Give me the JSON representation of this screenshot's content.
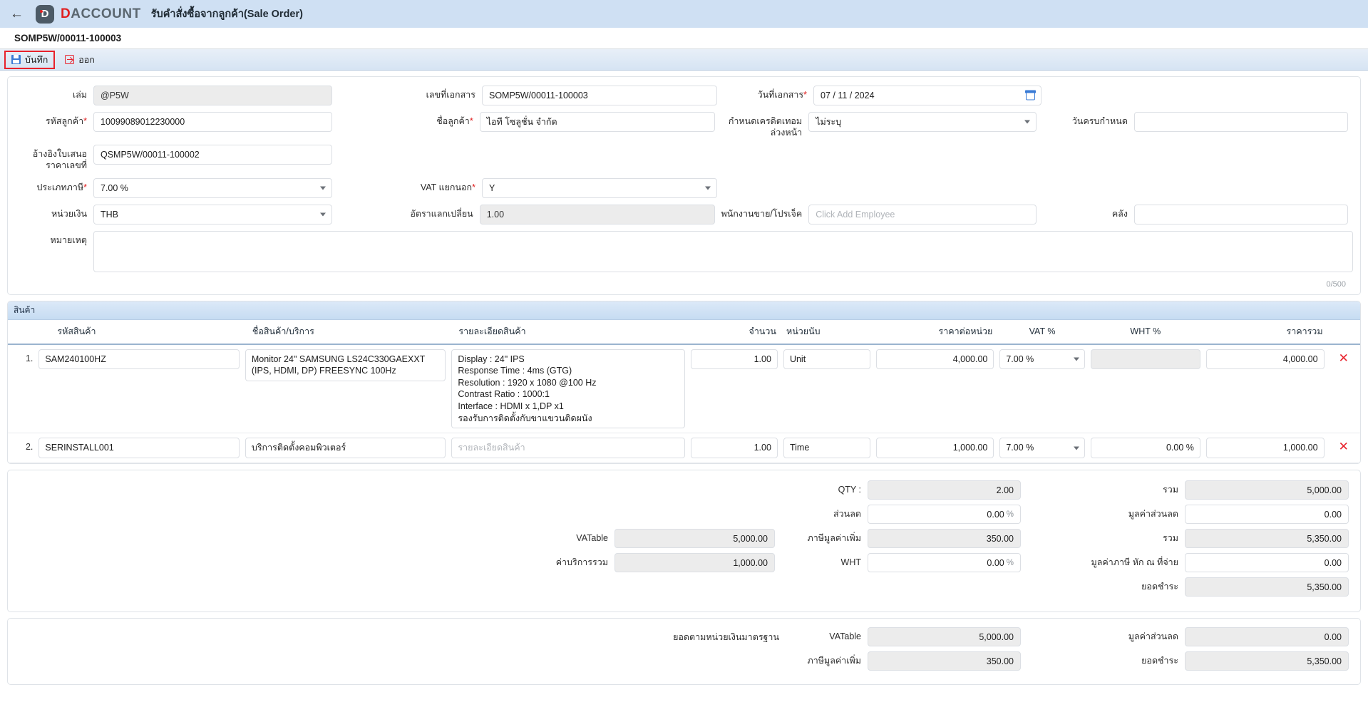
{
  "appbar": {
    "back_icon": "arrow-left-icon",
    "brand_first": "D",
    "brand_rest": "ACCOUNT",
    "title": "รับคำสั่งซื้อจากลูกค้า(Sale Order)"
  },
  "doc_no": "SOMP5W/00011-100003",
  "toolbar": {
    "save_label": "บันทึก",
    "exit_label": "ออก"
  },
  "form": {
    "book_label": "เล่ม",
    "book_value": "@P5W",
    "docno_label": "เลขที่เอกสาร",
    "docno_value": "SOMP5W/00011-100003",
    "docdate_label": "วันที่เอกสาร",
    "docdate_value": "07 / 11 / 2024",
    "custcode_label": "รหัสลูกค้า",
    "custcode_value": "10099089012230000",
    "custname_label": "ชื่อลูกค้า",
    "custname_value": "ไอที โซลูชั่น จำกัด",
    "credit_label": "กำหนดเครดิตเทอมล่วงหน้า",
    "credit_value": "ไม่ระบุ",
    "duedate_label": "วันครบกำหนด",
    "duedate_value": "",
    "quoteref_label": "อ้างอิงใบเสนอราคาเลขที่",
    "quoteref_value": "QSMP5W/00011-100002",
    "taxtype_label": "ประเภทภาษี",
    "taxtype_value": "7.00 %",
    "vatout_label": "VAT แยกนอก",
    "vatout_value": "Y",
    "currency_label": "หน่วยเงิน",
    "currency_value": "THB",
    "exrate_label": "อัตราแลกเปลี่ยน",
    "exrate_value": "1.00",
    "employee_label": "พนักงานขาย/โปรเจ็ค",
    "employee_placeholder": "Click Add Employee",
    "employee_value": "",
    "warehouse_label": "คลัง",
    "warehouse_value": "",
    "note_label": "หมายเหตุ",
    "note_value": "",
    "note_counter": "0/500"
  },
  "items": {
    "section_title": "สินค้า",
    "columns": {
      "code": "รหัสสินค้า",
      "name": "ชื่อสินค้า/บริการ",
      "detail": "รายละเอียดสินค้า",
      "qty": "จำนวน",
      "unit": "หน่วยนับ",
      "price": "ราคาต่อหน่วย",
      "vat": "VAT %",
      "wht": "WHT %",
      "total": "ราคารวม"
    },
    "detail_placeholder": "รายละเอียดสินค้า",
    "rows": [
      {
        "index": "1.",
        "code": "SAM240100HZ",
        "name": "Monitor 24\" SAMSUNG LS24C330GAEXXT (IPS, HDMI, DP) FREESYNC 100Hz",
        "detail": "Display : 24\" IPS\nResponse Time : 4ms (GTG)\nResolution : 1920 x 1080 @100 Hz\nContrast Ratio : 1000:1\nInterface : HDMI x 1,DP x1\nรองรับการติดตั้งกับขาแขวนติดผนัง",
        "detail_is_placeholder": false,
        "qty": "1.00",
        "unit": "Unit",
        "price": "4,000.00",
        "vat": "7.00 %",
        "wht": "",
        "wht_readonly": true,
        "total": "4,000.00",
        "delete_icon": "delete-row-icon"
      },
      {
        "index": "2.",
        "code": "SERINSTALL001",
        "name": "บริการติดตั้งคอมพิวเตอร์",
        "detail": "รายละเอียดสินค้า",
        "detail_is_placeholder": true,
        "qty": "1.00",
        "unit": "Time",
        "price": "1,000.00",
        "vat": "7.00 %",
        "wht": "0.00 %",
        "wht_readonly": false,
        "total": "1,000.00",
        "delete_icon": "delete-row-icon"
      }
    ]
  },
  "summary": {
    "qty_label": "QTY :",
    "qty_value": "2.00",
    "sum_label": "รวม",
    "sum_value": "5,000.00",
    "discount_label": "ส่วนลด",
    "discount_value": "0.00",
    "discount_pct": "%",
    "discount_amt_label": "มูลค่าส่วนลด",
    "discount_amt_value": "0.00",
    "vatable_label": "VATable",
    "vatable_value": "5,000.00",
    "vat_label": "ภาษีมูลค่าเพิ่ม",
    "vat_value": "350.00",
    "sum2_label": "รวม",
    "sum2_value": "5,350.00",
    "service_label": "ค่าบริการรวม",
    "service_value": "1,000.00",
    "wht_label": "WHT",
    "wht_value": "0.00",
    "wht_pct": "%",
    "wht_amt_label": "มูลค่าภาษี หัก ณ ที่จ่าย",
    "wht_amt_value": "0.00",
    "payable_label": "ยอดชำระ",
    "payable_value": "5,350.00"
  },
  "base": {
    "title": "ยอดตามหน่วยเงินมาตรฐาน",
    "vatable_label": "VATable",
    "vatable_value": "5,000.00",
    "discount_amt_label": "มูลค่าส่วนลด",
    "discount_amt_value": "0.00",
    "vat_label": "ภาษีมูลค่าเพิ่ม",
    "vat_value": "350.00",
    "payable_label": "ยอดชำระ",
    "payable_value": "5,350.00"
  }
}
